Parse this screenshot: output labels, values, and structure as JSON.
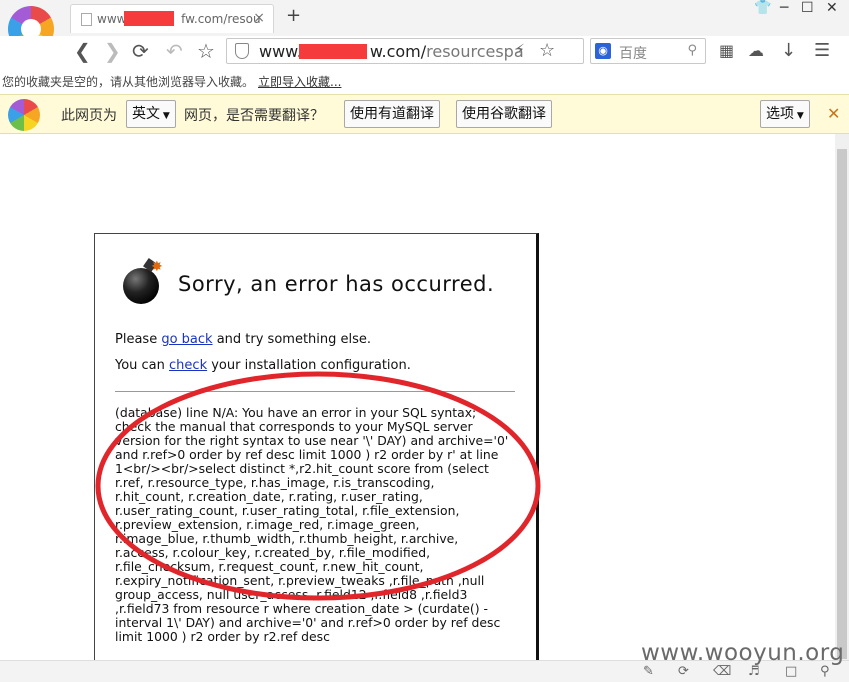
{
  "browser": {
    "tab": {
      "title_prefix": "www.",
      "title_suffix": "fw.com/resou",
      "close": "×"
    },
    "new_tab": "+",
    "url": {
      "prefix": "www.",
      "domain_suffix": "w.com/",
      "path": "resourcespa"
    },
    "search": {
      "placeholder": "百度"
    },
    "bookmarks": {
      "message": "您的收藏夹是空的，请从其他浏览器导入收藏。",
      "import_link": "立即导入收藏..."
    }
  },
  "translate_bar": {
    "prefix": "此网页为",
    "language": "英文",
    "question": "网页，是否需要翻译？",
    "youdao": "使用有道翻译",
    "google": "使用谷歌翻译",
    "options": "选项"
  },
  "error_page": {
    "title": "Sorry, an error has occurred.",
    "line1_pre": "Please ",
    "line1_link": "go back",
    "line1_post": " and try something else.",
    "line2_pre": "You can ",
    "line2_link": "check",
    "line2_post": " your installation configuration.",
    "sql_error": "(database) line N/A: You have an error in your SQL syntax;\ncheck the manual that corresponds to your MySQL server\nversion for the right syntax to use near '\\' DAY) and archive='0'\nand r.ref>0 order by ref desc limit 1000 ) r2 order by r' at line\n1<br/><br/>select distinct *,r2.hit_count score from (select\nr.ref, r.resource_type, r.has_image, r.is_transcoding,\nr.hit_count, r.creation_date, r.rating, r.user_rating,\nr.user_rating_count, r.user_rating_total, r.file_extension,\nr.preview_extension, r.image_red, r.image_green,\nr.image_blue, r.thumb_width, r.thumb_height, r.archive,\nr.access, r.colour_key, r.created_by, r.file_modified,\nr.file_checksum, r.request_count, r.new_hit_count,\nr.expiry_notification_sent, r.preview_tweaks ,r.file_path ,null\ngroup_access, null user_access ,r.field12 ,r.field8 ,r.field3\n,r.field73 from resource r where creation_date > (curdate() -\ninterval 1\\' DAY) and archive='0' and r.ref>0 order by ref desc\nlimit 1000 ) r2 order by r2.ref desc"
  },
  "watermark": "www.wooyun.org",
  "colors": {
    "redaction": "#f53b3b",
    "annotation": "#e0262b",
    "link": "#1a33c0",
    "translate_bg": "#fffbd8"
  }
}
